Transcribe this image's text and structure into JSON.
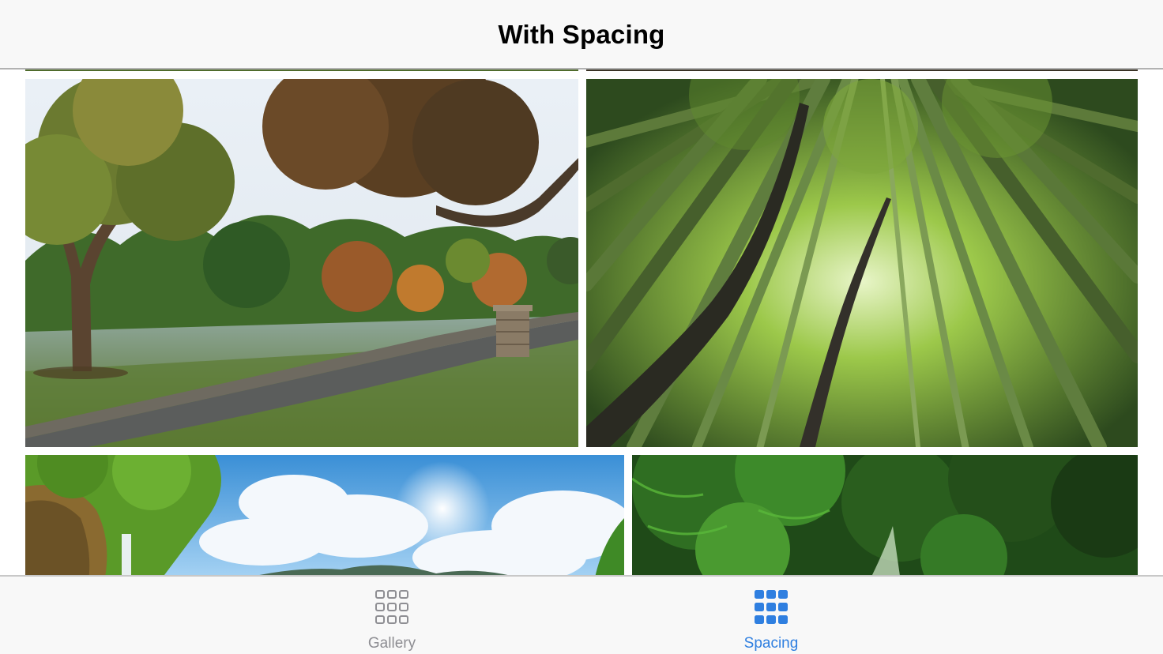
{
  "navbar": {
    "title": "With Spacing"
  },
  "photos": {
    "row1": [
      {
        "subject": "park-path-autumn-trees"
      },
      {
        "subject": "bamboo-forest"
      }
    ],
    "row2": [
      {
        "subject": "waterfall-blue-sky"
      },
      {
        "subject": "green-jungle-canopy"
      }
    ]
  },
  "tabbar": {
    "items": [
      {
        "label": "Gallery",
        "icon": "grid-outline-icon",
        "selected": false
      },
      {
        "label": "Spacing",
        "icon": "grid-filled-icon",
        "selected": true
      }
    ],
    "active_color": "#2f7fe0",
    "inactive_color": "#8e8e93"
  }
}
